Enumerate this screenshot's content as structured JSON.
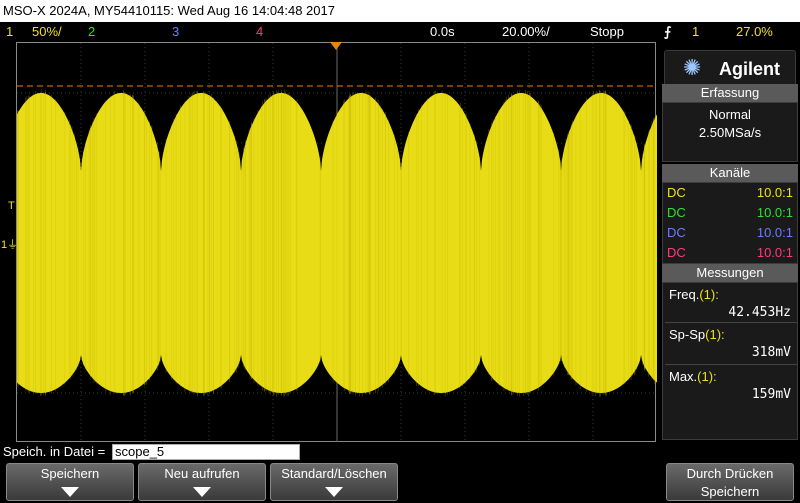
{
  "title": "MSO-X 2024A, MY54410115: Wed Aug 16 14:04:48 2017",
  "status": {
    "ch1_num": "1",
    "ch1_scale": "50%/",
    "ch2_num": "2",
    "ch3_num": "3",
    "ch4_num": "4",
    "delay": "0.0s",
    "timebase": "20.00%/",
    "run_state": "Stopp",
    "trigger_icon": "trigger-edge-icon",
    "trigger_glyph": "⨍",
    "trigger_source": "1",
    "trigger_level": "27.0%"
  },
  "scope": {
    "trigger_label": "T",
    "ch1_marker": "1",
    "ground_glyph": "⏚"
  },
  "panel": {
    "brand": "Agilent",
    "brand_glyph": "✺",
    "acquisition_header": "Erfassung",
    "acquisition_mode": "Normal",
    "sample_rate": "2.50MSa/s",
    "channels_header": "Kanäle",
    "channels": [
      {
        "coupling": "DC",
        "probe": "10.0:1"
      },
      {
        "coupling": "DC",
        "probe": "10.0:1"
      },
      {
        "coupling": "DC",
        "probe": "10.0:1"
      },
      {
        "coupling": "DC",
        "probe": "10.0:1"
      }
    ],
    "measurements_header": "Messungen",
    "measurements": [
      {
        "label": "Freq.",
        "channel": "(1):",
        "value": "42.453Hz"
      },
      {
        "label": "Sp-Sp",
        "channel": "(1):",
        "value": "318mV"
      },
      {
        "label": "Max.",
        "channel": "(1):",
        "value": "159mV"
      }
    ]
  },
  "file": {
    "label": "Speich. in Datei =",
    "value": "scope_5"
  },
  "softkeys": [
    {
      "label": "Speichern"
    },
    {
      "label": "Neu aufrufen"
    },
    {
      "label": "Standard/Löschen"
    },
    {
      "label": "Durch Drücken",
      "label2": "Speichern"
    }
  ],
  "colors": {
    "ch1": "#f0e020",
    "ch2": "#30e030",
    "ch3": "#6a7cff",
    "ch4": "#ff3a7a",
    "trigger": "#f08000",
    "waveform": "#e8dc16"
  },
  "waveform": {
    "bursts": 8,
    "min_band_level": 0.32,
    "max_band_level": 0.58
  }
}
